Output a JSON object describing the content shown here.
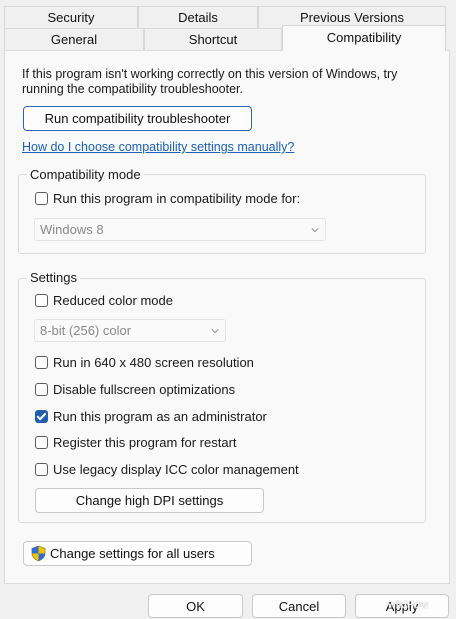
{
  "tabs": {
    "row_back": [
      "Security",
      "Details",
      "Previous Versions"
    ],
    "row_front": [
      "General",
      "Shortcut",
      "Compatibility"
    ],
    "active": "Compatibility"
  },
  "intro_text": "If this program isn't working correctly on this version of Windows, try running the compatibility troubleshooter.",
  "troubleshooter_button": "Run compatibility troubleshooter",
  "help_link": "How do I choose compatibility settings manually?",
  "compat_mode": {
    "legend": "Compatibility mode",
    "checkbox_label": "Run this program in compatibility mode for:",
    "checked": false,
    "selected_os": "Windows 8"
  },
  "settings": {
    "legend": "Settings",
    "reduced_color": {
      "label": "Reduced color mode",
      "checked": false
    },
    "color_select": "8-bit (256) color",
    "res_640": {
      "label": "Run in 640 x 480 screen resolution",
      "checked": false
    },
    "fullscreen_opt": {
      "label": "Disable fullscreen optimizations",
      "checked": false
    },
    "run_admin": {
      "label": "Run this program as an administrator",
      "checked": true
    },
    "register_restart": {
      "label": "Register this program for restart",
      "checked": false
    },
    "legacy_icc": {
      "label": "Use legacy display ICC color management",
      "checked": false
    },
    "dpi_button": "Change high DPI settings"
  },
  "all_users_button": "Change settings for all users",
  "footer": {
    "ok": "OK",
    "cancel": "Cancel",
    "apply": "Apply"
  },
  "watermark": "wikiHow"
}
